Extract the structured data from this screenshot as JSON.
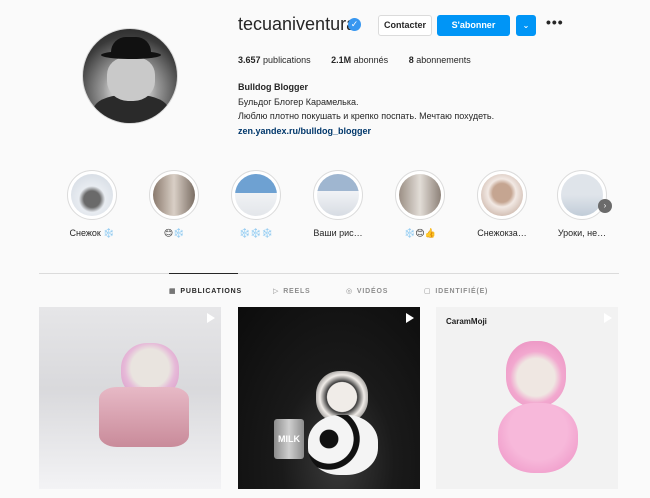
{
  "profile": {
    "username": "tecuaniventura",
    "verified_badge": "✓",
    "buttons": {
      "contact": "Contacter",
      "follow": "S'abonner",
      "dropdown": "⌄",
      "more": "•••"
    },
    "stats": {
      "publications_value": "3.657",
      "publications_label": "publications",
      "followers_value": "2.1M",
      "followers_label": "abonnés",
      "following_value": "8",
      "following_label": "abonnements"
    },
    "full_name": "Bulldog Blogger",
    "bio_line1": "Бульдог Блогер Карамелька.",
    "bio_line2": "Люблю плотно покушать и крепко поспать. Мечтаю похудеть.",
    "link": "zen.yandex.ru/bulldog_blogger"
  },
  "highlights": [
    {
      "label": "Снежок ❄️",
      "color": "#cfd6df"
    },
    {
      "label": "😊❄️",
      "color": "#b7a79a"
    },
    {
      "label": "❄️❄️❄️",
      "color": "#8fb3d6"
    },
    {
      "label": "Ваши рис…",
      "color": "#c7cfdb"
    },
    {
      "label": "❄️😊👍",
      "color": "#b9b2a8"
    },
    {
      "label": "Снежокза…",
      "color": "#b99a8a"
    },
    {
      "label": "Уроки, не…",
      "color": "#a9b8c8"
    }
  ],
  "highlight_arrow": "›",
  "tabs": [
    {
      "icon": "▦",
      "label": "PUBLICATIONS",
      "active": true
    },
    {
      "icon": "▷",
      "label": "REELS",
      "active": false
    },
    {
      "icon": "◎",
      "label": "VIDÉOS",
      "active": false
    },
    {
      "icon": "▢",
      "label": "IDENTIFIÉ(E)",
      "active": false
    }
  ],
  "posts": {
    "post3_logo": "CaramMoji",
    "post2_milk": "MILK"
  },
  "colors": {
    "accent": "#0095f6",
    "link": "#00376b",
    "text": "#262626",
    "muted": "#8e8e8e"
  }
}
